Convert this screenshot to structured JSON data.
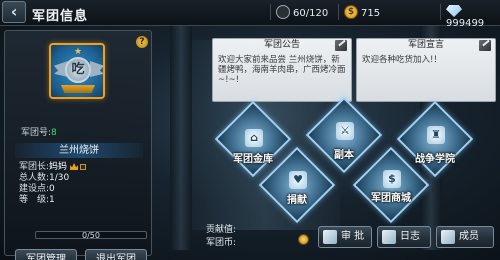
{
  "header": {
    "back_icon": "back-arrow-icon",
    "title": "军团信息",
    "stamina": "60/120",
    "gold": "715",
    "diamonds": "999499"
  },
  "guild": {
    "help_icon": "question-icon",
    "emblem_char": "吃",
    "id_label": "军团号:",
    "id_value": "8",
    "name": "兰州烧饼",
    "stats": [
      {
        "label": "军团长:",
        "value": "妈妈"
      },
      {
        "label": "总人数:",
        "value": "1/30"
      },
      {
        "label": "建设点:",
        "value": "0"
      },
      {
        "label": "等　级:",
        "value": "1"
      }
    ],
    "progress_text": "0/50",
    "progress_fraction": 0,
    "manage_button": "军团管理",
    "quit_button": "退出军团"
  },
  "notices": {
    "announcement_title": "军团公告",
    "announcement_text": "欢迎大家前来品尝 兰州烧饼，新疆烤鸭，海南羊肉串，广西烤冷面~!~!",
    "declaration_title": "军团宣言",
    "declaration_text": "欢迎各种吃货加入!！"
  },
  "menu": {
    "items": [
      {
        "label": "军团金库",
        "icon": "vault-icon",
        "glyph": "⌂"
      },
      {
        "label": "副本",
        "icon": "dungeon-icon",
        "glyph": "⚔"
      },
      {
        "label": "战争学院",
        "icon": "academy-icon",
        "glyph": "♜"
      },
      {
        "label": "捐献",
        "icon": "donate-icon",
        "glyph": "♥"
      },
      {
        "label": "军团商城",
        "icon": "shop-icon",
        "glyph": "$"
      }
    ]
  },
  "footer": {
    "contribution_label": "贡献值:",
    "coin_label": "军团币:",
    "approve_button": "审 批",
    "log_button": "日志",
    "members_button": "成员"
  }
}
